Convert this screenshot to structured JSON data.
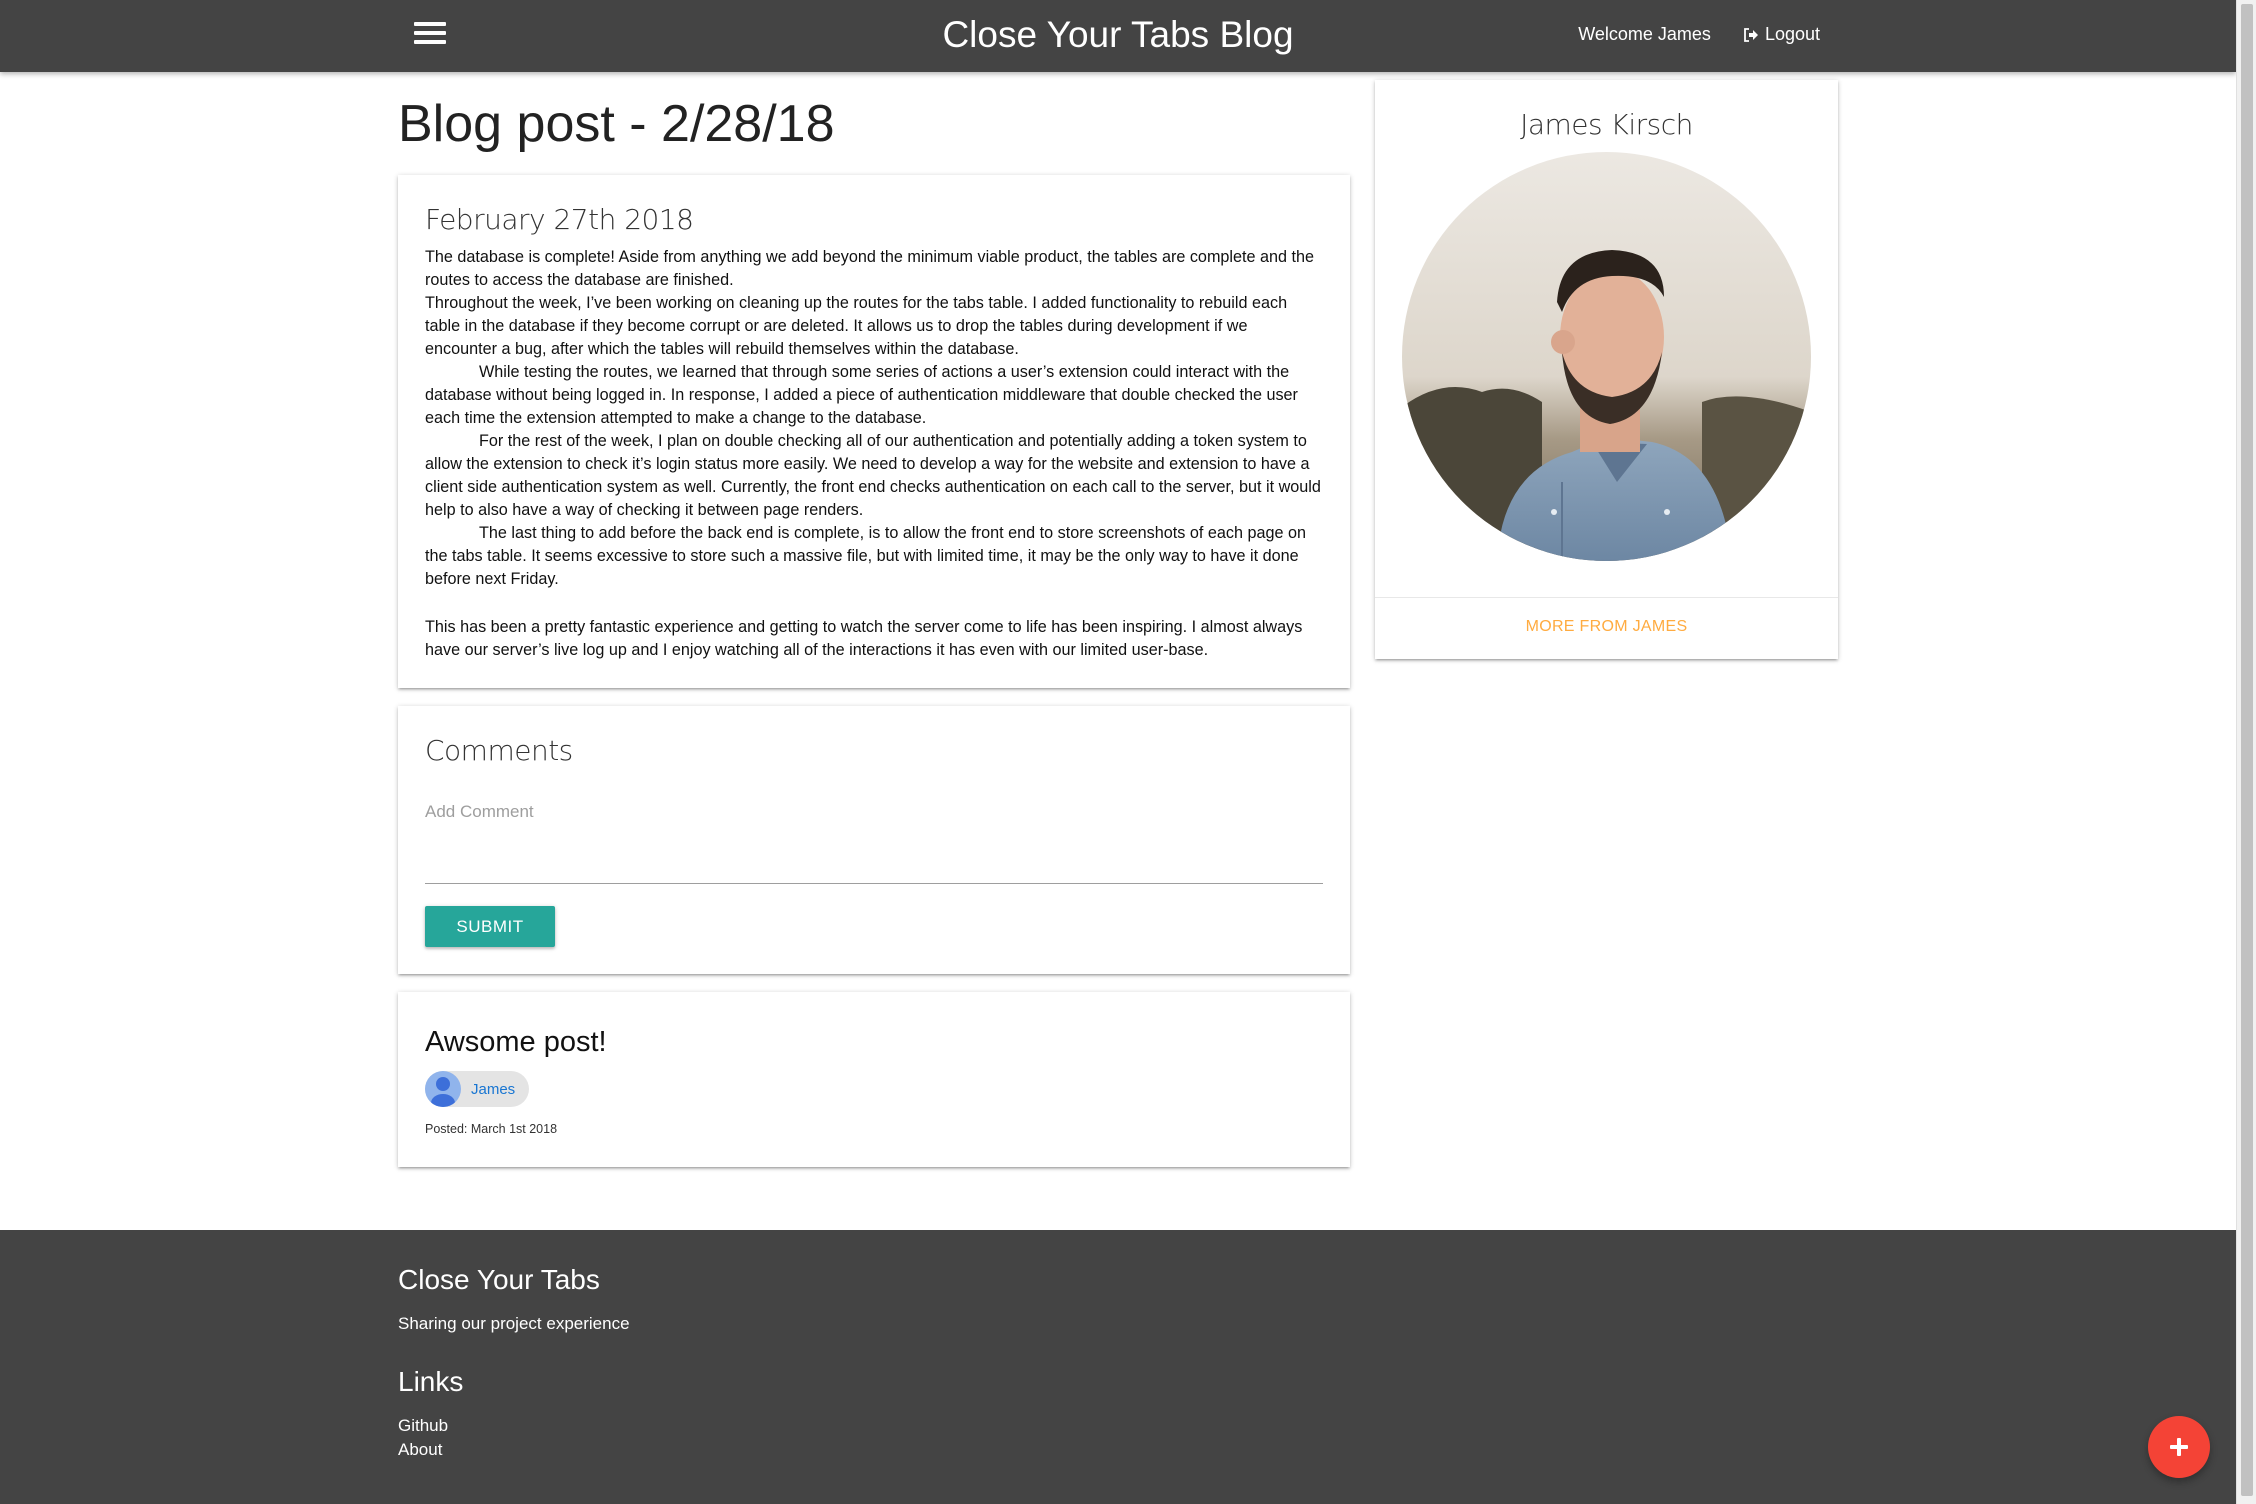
{
  "navbar": {
    "menu_icon": "hamburger-menu-icon",
    "brand": "Close Your Tabs Blog",
    "welcome": "Welcome James",
    "logout_icon": "sign-out-icon",
    "logout": "Logout"
  },
  "page": {
    "title": "Blog post - 2/28/18"
  },
  "post": {
    "date": "February 27th 2018",
    "paragraphs": [
      "The database is complete!  Aside from anything we add beyond the minimum viable product, the tables are complete and the routes to access the database are finished.",
      "Throughout the week, I’ve been working on cleaning up the routes for the tabs table.  I added functionality to rebuild each table in the database if they become corrupt or are deleted.  It allows us to drop the tables during development if we encounter a bug, after which the tables will rebuild themselves within the database.",
      "While testing the routes, we learned that through some series of actions a user’s extension could interact with the database without being logged in.  In response, I added a piece of authentication middleware that double checked the user each time the extension attempted to make a change to the database.",
      "For the rest of the week, I plan on double checking all of our authentication and potentially adding a token system to allow the extension to check it’s login status more easily.  We need to develop a way for the website and extension to have a client side authentication system as well.  Currently, the front end checks authentication on each call to the server, but it would help to also have a way of checking it between page renders.",
      "The last thing to add before the back end is complete, is to allow the front end to store screenshots of each page on the tabs table.  It seems excessive to store such a massive file, but with limited time, it may be the only way to have it done before next Friday.",
      "This has been a pretty fantastic experience and getting to watch the server come to life has been inspiring.  I almost always have our server’s live log up and I enjoy watching all of the interactions it has even with our limited user-base."
    ]
  },
  "comments": {
    "title": "Comments",
    "input_label": "Add Comment",
    "input_value": "",
    "submit": "SUBMIT",
    "items": [
      {
        "text": "Awsome post!",
        "author": "James",
        "author_icon": "user-avatar-icon",
        "posted": "Posted: March 1st 2018"
      }
    ]
  },
  "profile": {
    "name": "James Kirsch",
    "photo": "author-portrait-photo",
    "more": "MORE FROM JAMES"
  },
  "footer": {
    "title": "Close Your Tabs",
    "tagline": "Sharing our project experience",
    "links_title": "Links",
    "links": [
      "Github",
      "About"
    ]
  },
  "fab": {
    "icon": "plus-icon"
  },
  "colors": {
    "navbar": "#444444",
    "submit": "#26a69a",
    "more_link": "#ffab40",
    "fab": "#f44336",
    "chip_link": "#1976d2"
  }
}
